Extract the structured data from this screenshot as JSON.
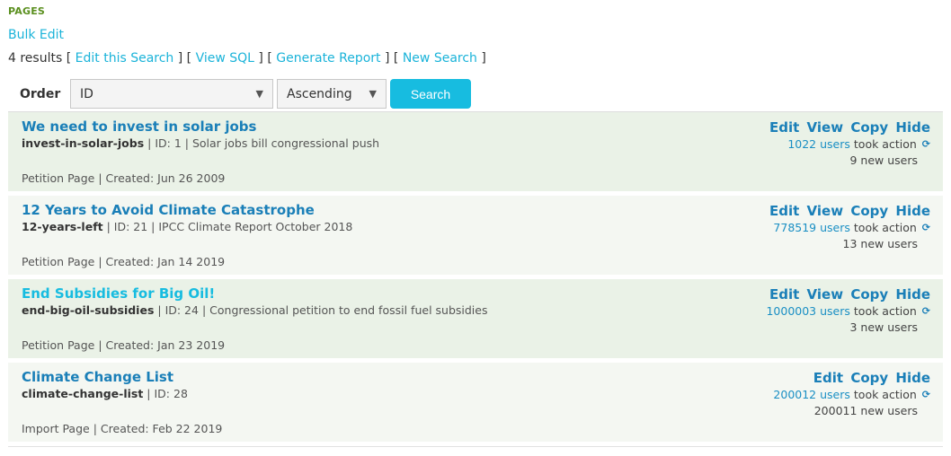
{
  "section": {
    "title": "PAGES"
  },
  "bulk_edit": "Bulk Edit",
  "results": {
    "count_text": "4 results",
    "links": [
      "Edit this Search",
      "View SQL",
      "Generate Report",
      "New Search"
    ]
  },
  "order": {
    "label": "Order",
    "field_value": "ID",
    "direction_value": "Ascending",
    "search_button": "Search",
    "arrow_glyph": "▼"
  },
  "rows": [
    {
      "title": "We need to invest in solar jobs",
      "slug": "invest-in-solar-jobs",
      "id_text": "ID: 1",
      "description": "Solar jobs bill congressional push",
      "page_type": "Petition Page",
      "created": "Created: Jun 26 2009",
      "actions": [
        "Edit",
        "View",
        "Copy",
        "Hide"
      ],
      "users_link": "1022 users",
      "took_action": "took action",
      "new_users": "9 new users"
    },
    {
      "title": "12 Years to Avoid Climate Catastrophe",
      "slug": "12-years-left",
      "id_text": "ID: 21",
      "description": "IPCC Climate Report October 2018",
      "page_type": "Petition Page",
      "created": "Created: Jan 14 2019",
      "actions": [
        "Edit",
        "View",
        "Copy",
        "Hide"
      ],
      "users_link": "778519 users",
      "took_action": "took action",
      "new_users": "13 new users"
    },
    {
      "title": "End Subsidies for Big Oil!",
      "slug": "end-big-oil-subsidies",
      "id_text": "ID: 24",
      "description": "Congressional petition to end fossil fuel subsidies",
      "page_type": "Petition Page",
      "created": "Created: Jan 23 2019",
      "actions": [
        "Edit",
        "View",
        "Copy",
        "Hide"
      ],
      "users_link": "1000003 users",
      "took_action": "took action",
      "new_users": "3 new users"
    },
    {
      "title": "Climate Change List",
      "slug": "climate-change-list",
      "id_text": "ID: 28",
      "description": "",
      "page_type": "Import Page",
      "created": "Created: Feb 22 2019",
      "actions": [
        "Edit",
        "Copy",
        "Hide"
      ],
      "users_link": "200012 users",
      "took_action": "took action",
      "new_users": "200011 new users"
    }
  ],
  "separators": {
    "pipe": " | ",
    "open_bracket": " [ ",
    "close_bracket": " ]"
  },
  "icons": {
    "refresh": "⟳"
  },
  "colors": {
    "section_green": "#5a8f1e",
    "link_cyan": "#1ab3d9",
    "title_blue": "#1a7fb8",
    "button_cyan": "#17bce0"
  }
}
